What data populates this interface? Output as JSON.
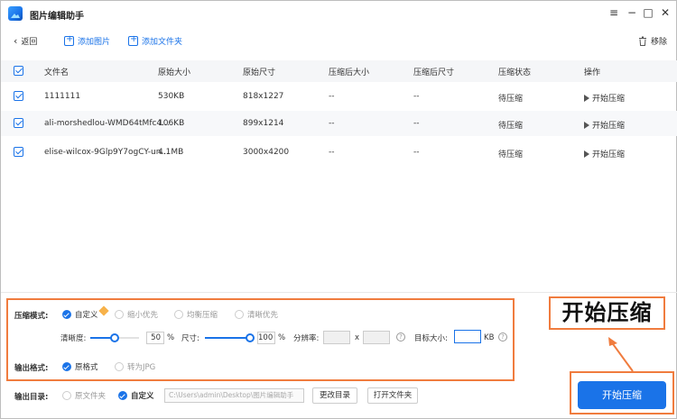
{
  "app": {
    "title": "图片编辑助手"
  },
  "window_controls": {
    "menu": "≡",
    "minimize": "−",
    "maximize": "□",
    "close": "✕"
  },
  "toolbar": {
    "back": "返回",
    "add_image": "添加图片",
    "add_folder": "添加文件夹",
    "remove": "移除"
  },
  "table": {
    "headers": [
      "文件名",
      "原始大小",
      "原始尺寸",
      "压缩后大小",
      "压缩后尺寸",
      "压缩状态",
      "操作"
    ],
    "rows": [
      {
        "name": "1111111",
        "orig_size": "530KB",
        "orig_dim": "818x1227",
        "comp_size": "--",
        "comp_dim": "--",
        "status": "待压缩",
        "action": "开始压缩"
      },
      {
        "name": "ali-morshedlou-WMD64tMfc4...",
        "orig_size": "106KB",
        "orig_dim": "899x1214",
        "comp_size": "--",
        "comp_dim": "--",
        "status": "待压缩",
        "action": "开始压缩"
      },
      {
        "name": "elise-wilcox-9Glp9Y7ogCY-un...",
        "orig_size": "4.1MB",
        "orig_dim": "3000x4200",
        "comp_size": "--",
        "comp_dim": "--",
        "status": "待压缩",
        "action": "开始压缩"
      }
    ]
  },
  "settings": {
    "mode_label": "压缩模式:",
    "modes": [
      "自定义",
      "缩小优先",
      "均衡压缩",
      "清晰优先"
    ],
    "selected_mode": "自定义",
    "clarity_label": "清晰度:",
    "clarity_value": "50",
    "clarity_percent": 50,
    "size_label": "尺寸:",
    "size_value": "100",
    "size_percent": 100,
    "percent_unit": "%",
    "resolution_label": "分辨率:",
    "resolution_x": "x",
    "target_label": "目标大小:",
    "target_unit": "KB",
    "help_glyph": "?",
    "format_label": "输出格式:",
    "formats": [
      "原格式",
      "转为JPG"
    ],
    "selected_format": "原格式",
    "output_dir_label": "输出目录:",
    "output_dirs": [
      "原文件夹",
      "自定义"
    ],
    "selected_output_dir": "自定义",
    "output_path_placeholder": "C:\\Users\\admin\\Desktop\\图片编辑助手",
    "change_dir_button": "更改目录",
    "open_folder_button": "打开文件夹"
  },
  "annotation": {
    "text": "开始压缩"
  },
  "start_button": {
    "label": "开始压缩"
  },
  "colors": {
    "accent": "#1a73e8",
    "highlight": "#f07c3e"
  }
}
